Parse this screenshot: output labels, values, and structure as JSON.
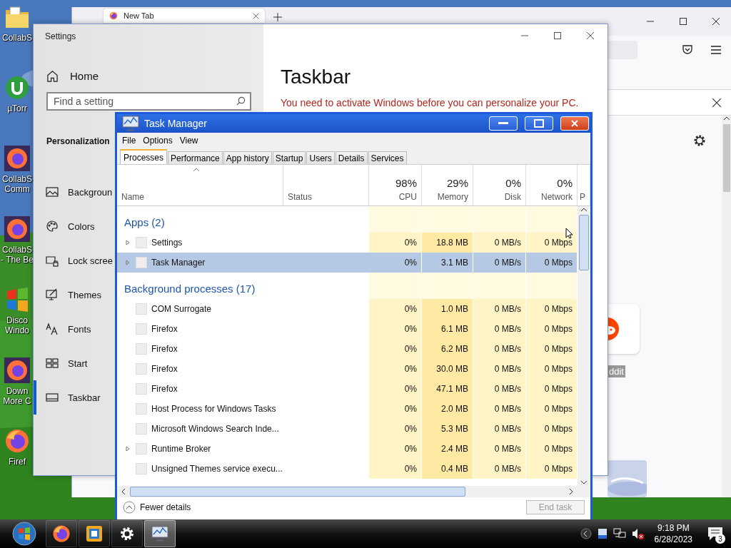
{
  "desktop": {
    "icons": [
      {
        "kind": "folder",
        "lines": [
          "CollabS"
        ]
      },
      {
        "kind": "torrent",
        "lines": [
          "µTorr"
        ]
      },
      {
        "kind": "firefox",
        "lines": [
          "CollabS",
          "Comm"
        ]
      },
      {
        "kind": "firefox",
        "lines": [
          "CollabS",
          "- The Be"
        ]
      },
      {
        "kind": "windows",
        "lines": [
          "Disco",
          "Windo"
        ]
      },
      {
        "kind": "firefox",
        "lines": [
          "Down",
          "More C"
        ]
      },
      {
        "kind": "firefox-plain",
        "lines": [
          "Firef"
        ]
      }
    ]
  },
  "browser_window": {
    "tab_title": "New Tab",
    "tile_label": "ddit"
  },
  "settings_window": {
    "title": "Settings",
    "home": "Home",
    "search": {
      "placeholder": "Find a setting"
    },
    "section": "Personalization",
    "nav": [
      {
        "kind": "background",
        "label": "Backgroun",
        "selected": false
      },
      {
        "kind": "colors",
        "label": "Colors",
        "selected": false
      },
      {
        "kind": "lock-screen",
        "label": "Lock scree",
        "selected": false
      },
      {
        "kind": "themes",
        "label": "Themes",
        "selected": false
      },
      {
        "kind": "fonts",
        "label": "Fonts",
        "selected": false
      },
      {
        "kind": "start",
        "label": "Start",
        "selected": false
      },
      {
        "kind": "taskbar",
        "label": "Taskbar",
        "selected": true
      }
    ],
    "heading": "Taskbar",
    "warning": "You need to activate Windows before you can personalize your PC."
  },
  "task_manager": {
    "title": "Task Manager",
    "menu": [
      "File",
      "Options",
      "View"
    ],
    "tabs": [
      {
        "label": "Processes",
        "selected": true
      },
      {
        "label": "Performance",
        "selected": false
      },
      {
        "label": "App history",
        "selected": false
      },
      {
        "label": "Startup",
        "selected": false
      },
      {
        "label": "Users",
        "selected": false
      },
      {
        "label": "Details",
        "selected": false
      },
      {
        "label": "Services",
        "selected": false
      }
    ],
    "columns": [
      {
        "label": "Name"
      },
      {
        "label": "Status"
      },
      {
        "label": "CPU",
        "total": "98%"
      },
      {
        "label": "Memory",
        "total": "29%"
      },
      {
        "label": "Disk",
        "total": "0%"
      },
      {
        "label": "Network",
        "total": "0%"
      },
      {
        "label": "P"
      }
    ],
    "rows": [
      {
        "kind": "group",
        "name": "Apps (2)"
      },
      {
        "kind": "process",
        "name": "Settings",
        "expandable": true,
        "selected": false,
        "cpu": "0%",
        "memory": "18.8 MB",
        "disk": "0 MB/s",
        "network": "0 Mbps"
      },
      {
        "kind": "process",
        "name": "Task Manager",
        "expandable": true,
        "selected": true,
        "cpu": "0%",
        "memory": "3.1 MB",
        "disk": "0 MB/s",
        "network": "0 Mbps"
      },
      {
        "kind": "group",
        "name": "Background processes (17)"
      },
      {
        "kind": "process",
        "name": "COM Surrogate",
        "expandable": false,
        "selected": false,
        "cpu": "0%",
        "memory": "1.0 MB",
        "disk": "0 MB/s",
        "network": "0 Mbps"
      },
      {
        "kind": "process",
        "name": "Firefox",
        "expandable": false,
        "selected": false,
        "cpu": "0%",
        "memory": "6.1 MB",
        "disk": "0 MB/s",
        "network": "0 Mbps"
      },
      {
        "kind": "process",
        "name": "Firefox",
        "expandable": false,
        "selected": false,
        "cpu": "0%",
        "memory": "6.2 MB",
        "disk": "0 MB/s",
        "network": "0 Mbps"
      },
      {
        "kind": "process",
        "name": "Firefox",
        "expandable": false,
        "selected": false,
        "cpu": "0%",
        "memory": "30.0 MB",
        "disk": "0 MB/s",
        "network": "0 Mbps"
      },
      {
        "kind": "process",
        "name": "Firefox",
        "expandable": false,
        "selected": false,
        "cpu": "0%",
        "memory": "47.1 MB",
        "disk": "0 MB/s",
        "network": "0 Mbps"
      },
      {
        "kind": "process",
        "name": "Host Process for Windows Tasks",
        "expandable": false,
        "selected": false,
        "cpu": "0%",
        "memory": "2.0 MB",
        "disk": "0 MB/s",
        "network": "0 Mbps"
      },
      {
        "kind": "process",
        "name": "Microsoft Windows Search Inde...",
        "expandable": false,
        "selected": false,
        "cpu": "0%",
        "memory": "5.3 MB",
        "disk": "0 MB/s",
        "network": "0 Mbps"
      },
      {
        "kind": "process",
        "name": "Runtime Broker",
        "expandable": true,
        "selected": false,
        "cpu": "0%",
        "memory": "2.4 MB",
        "disk": "0 MB/s",
        "network": "0 Mbps"
      },
      {
        "kind": "process",
        "name": "Unsigned Themes service execu...",
        "expandable": false,
        "selected": false,
        "cpu": "0%",
        "memory": "0.4 MB",
        "disk": "0 MB/s",
        "network": "0 Mbps"
      }
    ],
    "fewer_details": "Fewer details",
    "end_task": {
      "label": "End task",
      "disabled": true
    }
  },
  "taskbar": {
    "apps": [
      {
        "kind": "firefox",
        "selected": false
      },
      {
        "kind": "app",
        "selected": false
      },
      {
        "kind": "settings",
        "selected": false
      },
      {
        "kind": "task-manager",
        "selected": true
      }
    ],
    "time": "9:18 PM",
    "date": "6/28/2023",
    "notifications": "3"
  }
}
